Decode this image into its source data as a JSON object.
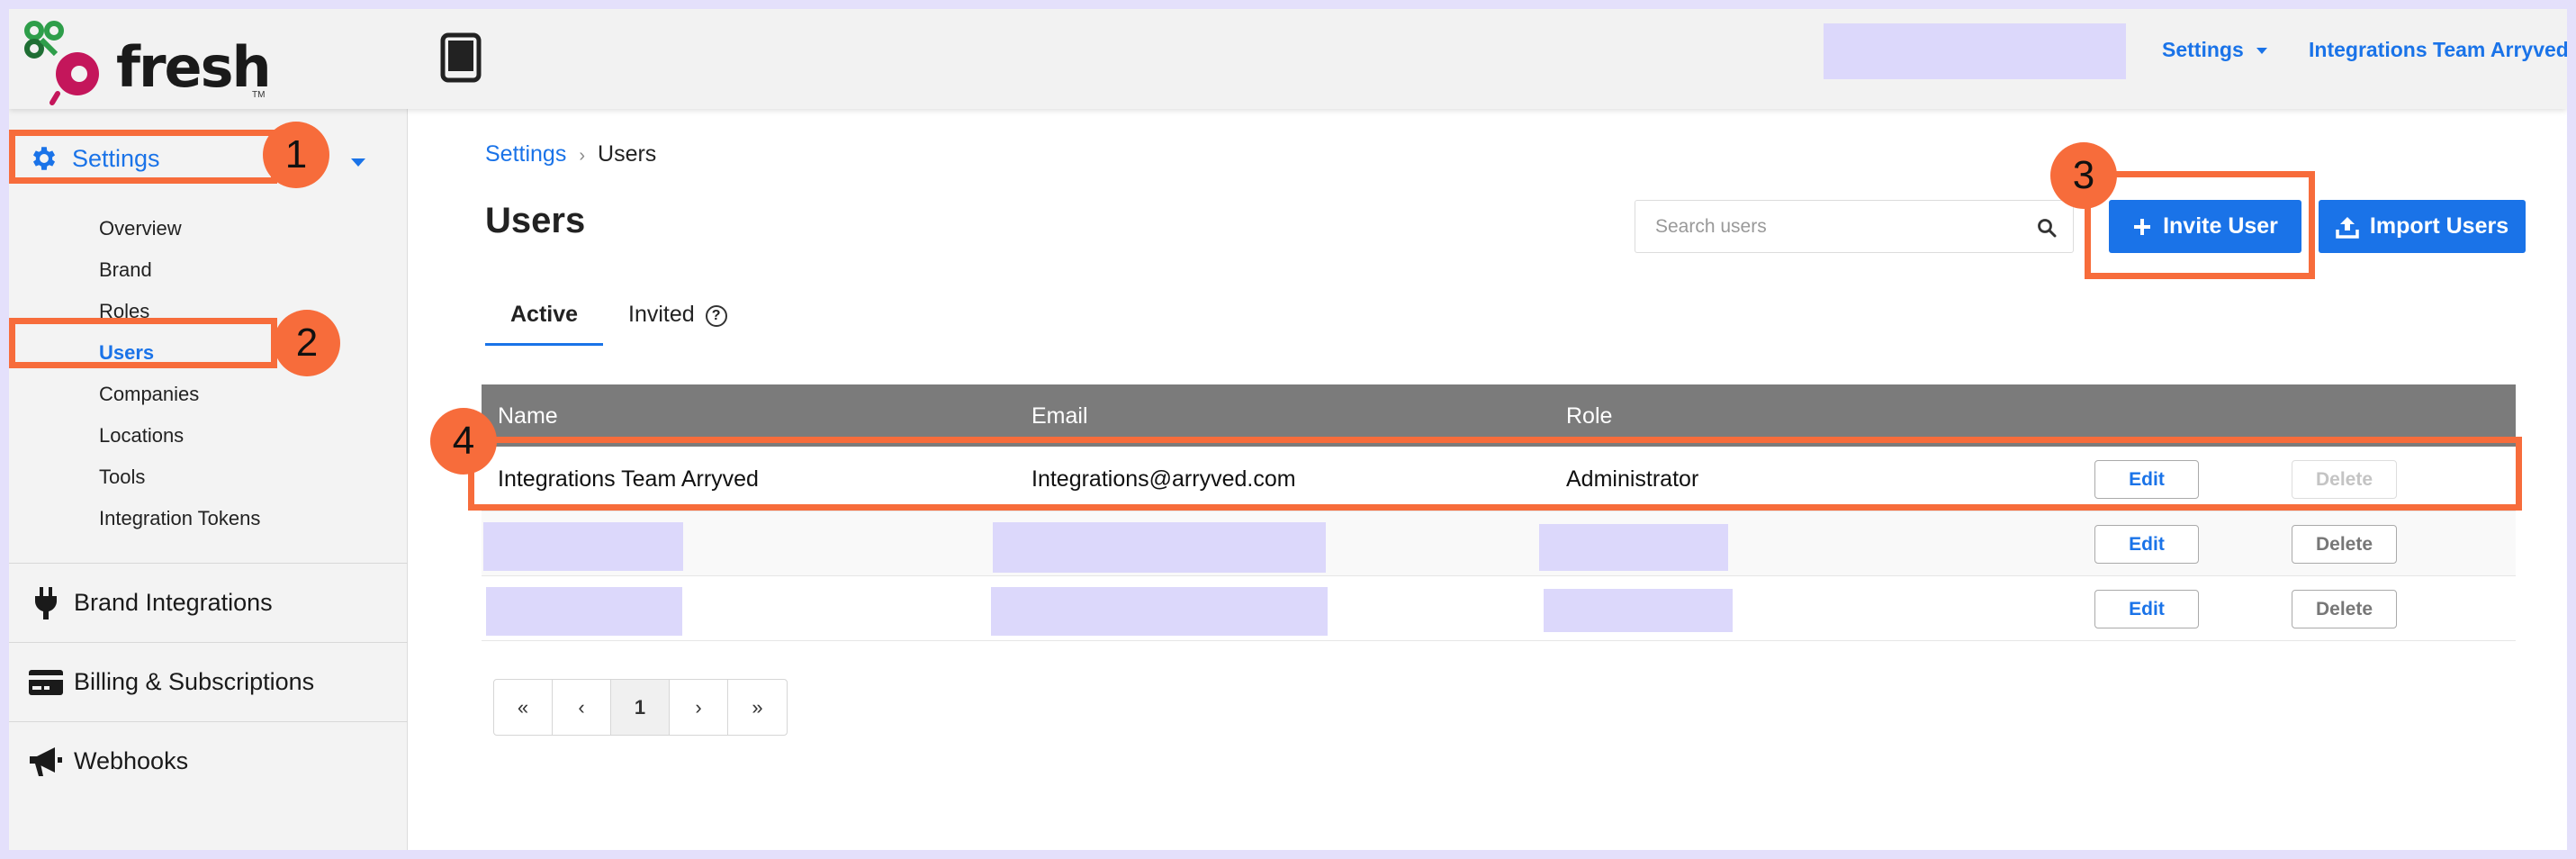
{
  "app": {
    "logo_text": "fresh",
    "logo_tm": "TM"
  },
  "topbar": {
    "settings_label": "Settings",
    "account_label": "Integrations Team Arryved"
  },
  "sidebar": {
    "header_label": "Settings",
    "items": [
      {
        "label": "Overview"
      },
      {
        "label": "Brand"
      },
      {
        "label": "Roles"
      },
      {
        "label": "Users"
      },
      {
        "label": "Companies"
      },
      {
        "label": "Locations"
      },
      {
        "label": "Tools"
      },
      {
        "label": "Integration Tokens"
      }
    ],
    "sections": [
      {
        "label": "Brand Integrations",
        "icon": "plug-icon"
      },
      {
        "label": "Billing & Subscriptions",
        "icon": "credit-card-icon"
      },
      {
        "label": "Webhooks",
        "icon": "megaphone-icon"
      }
    ]
  },
  "breadcrumb": {
    "parent": "Settings",
    "separator": "›",
    "current": "Users"
  },
  "page": {
    "title": "Users"
  },
  "search": {
    "placeholder": "Search users",
    "value": ""
  },
  "buttons": {
    "invite": "Invite User",
    "import": "Import Users"
  },
  "tabs": {
    "active": "Active",
    "invited": "Invited",
    "help": "?"
  },
  "table": {
    "headers": [
      "Name",
      "Email",
      "Role"
    ],
    "rows": [
      {
        "name": "Integrations Team Arryved",
        "email": "Integrations@arryved.com",
        "role": "Administrator",
        "edit": "Edit",
        "delete": "Delete",
        "delete_disabled": true
      },
      {
        "name": "",
        "email": "",
        "role": "",
        "edit": "Edit",
        "delete": "Delete",
        "delete_disabled": false
      },
      {
        "name": "",
        "email": "",
        "role": "",
        "edit": "Edit",
        "delete": "Delete",
        "delete_disabled": false
      }
    ]
  },
  "pagination": {
    "first": "«",
    "prev": "‹",
    "current": "1",
    "next": "›",
    "last": "»"
  },
  "annotations": [
    {
      "number": "1"
    },
    {
      "number": "2"
    },
    {
      "number": "3"
    },
    {
      "number": "4"
    }
  ],
  "colors": {
    "accent": "#1a73e8",
    "annotation": "#f76c3b",
    "redaction": "#dcd8fb",
    "table_header": "#7b7b7b"
  }
}
